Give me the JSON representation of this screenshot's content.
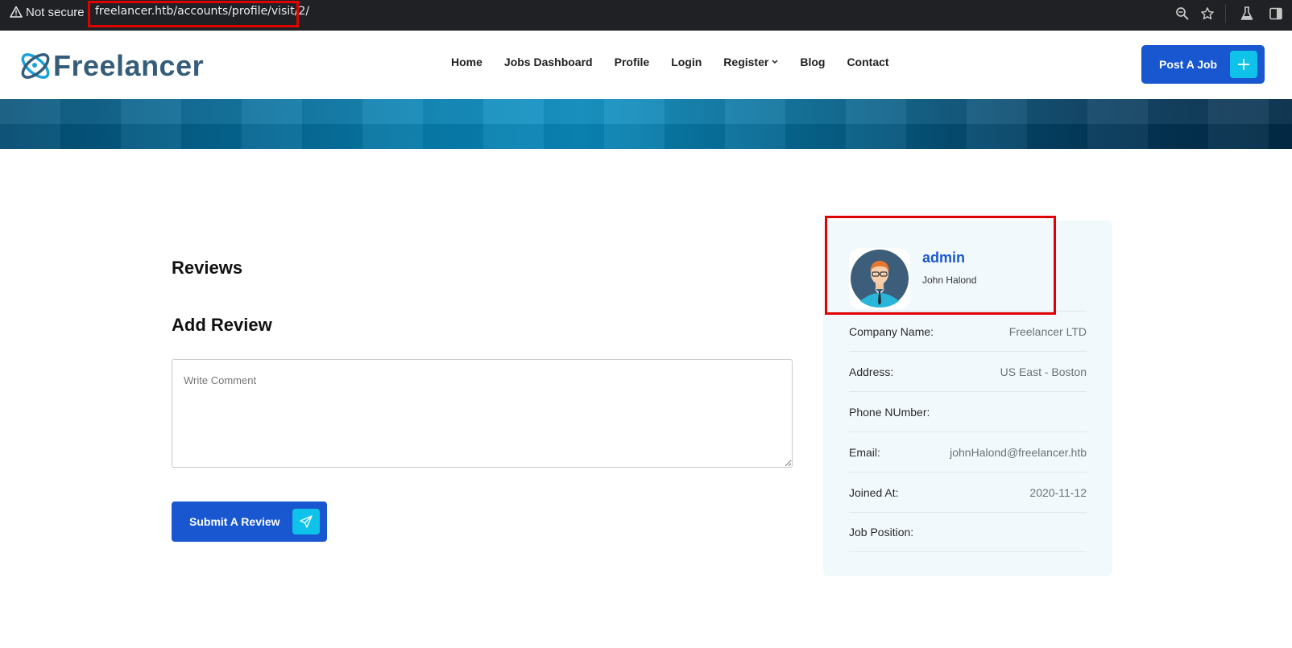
{
  "browser": {
    "security_label": "Not secure",
    "url": "freelancer.htb/accounts/profile/visit/2/",
    "icons": [
      "warning-icon",
      "zoom-icon",
      "bookmark-star-icon",
      "labs-flask-icon",
      "side-panel-icon"
    ]
  },
  "site": {
    "logo_text": "Freelancer",
    "nav": [
      {
        "label": "Home"
      },
      {
        "label": "Jobs Dashboard"
      },
      {
        "label": "Profile"
      },
      {
        "label": "Login"
      },
      {
        "label": "Register"
      },
      {
        "label": "Blog"
      },
      {
        "label": "Contact"
      }
    ],
    "post_job_label": "Post A Job",
    "colors": {
      "primary": "#1857cf",
      "accent": "#0fc2ea",
      "highlight": "#e00000"
    }
  },
  "main": {
    "reviews_title": "Reviews",
    "add_review_title": "Add Review",
    "comment_placeholder": "Write Comment",
    "submit_label": "Submit A Review"
  },
  "profile": {
    "username": "admin",
    "full_name": "John Halond",
    "details": [
      {
        "label": "Company Name:",
        "value": "Freelancer LTD"
      },
      {
        "label": "Address:",
        "value": "US East - Boston"
      },
      {
        "label": "Phone NUmber:",
        "value": ""
      },
      {
        "label": "Email:",
        "value": "johnHalond@freelancer.htb"
      },
      {
        "label": "Joined At:",
        "value": "2020-11-12"
      },
      {
        "label": "Job Position:",
        "value": ""
      }
    ]
  }
}
